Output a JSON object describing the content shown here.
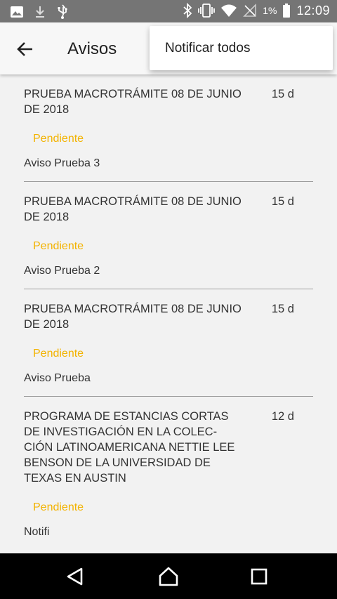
{
  "status_bar": {
    "time": "12:09",
    "battery_percent": "1%",
    "left_icons": [
      "image-icon",
      "download-icon",
      "usb-icon"
    ],
    "right_icons": [
      "bluetooth-icon",
      "vibrate-icon",
      "wifi-icon",
      "no-signal-icon",
      "battery-icon"
    ]
  },
  "app_bar": {
    "title": "Avisos",
    "back_icon": "arrow-back-icon"
  },
  "overflow_menu": {
    "items": [
      {
        "label": "Notificar todos"
      }
    ]
  },
  "notices": [
    {
      "title": "PRUEBA MACROTRÁMITE 08 DE JUNIO DE 2018",
      "age": "15 d",
      "status": "Pendiente",
      "description": "Aviso Prueba 3"
    },
    {
      "title": "PRUEBA MACROTRÁMITE 08 DE JUNIO DE 2018",
      "age": "15 d",
      "status": "Pendiente",
      "description": "Aviso Prueba 2"
    },
    {
      "title": "PRUEBA MACROTRÁMITE 08 DE JUNIO DE 2018",
      "age": "15 d",
      "status": "Pendiente",
      "description": "Aviso Prueba"
    },
    {
      "title": "PROGRAMA DE ESTANCIAS CORTAS DE INVESTIGACIÓN EN LA COLEC-CIÓN LATINOAMERICANA NETTIE LEE BENSON DE LA UNIVERSIDAD DE TEXAS EN AUSTIN",
      "age": "12 d",
      "status": "Pendiente",
      "description": "Notifi"
    }
  ],
  "nav_bar": {
    "buttons": [
      "back-triangle-icon",
      "home-icon",
      "recents-square-icon"
    ]
  },
  "colors": {
    "status_bar": "#757575",
    "app_bar": "#f7f7f7",
    "background": "#f2f2f2",
    "pending": "#f3b300",
    "divider": "#9e9e9e",
    "nav_bar": "#000000"
  }
}
